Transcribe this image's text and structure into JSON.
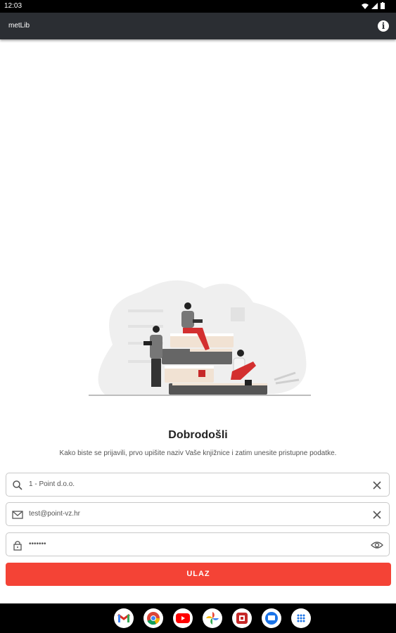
{
  "status": {
    "time": "12:03"
  },
  "appbar": {
    "title": "metLib",
    "info_icon": "info-icon"
  },
  "welcome": {
    "title": "Dobrodošli",
    "subtitle": "Kako biste se prijavili, prvo upišite naziv Vaše knjižnice i zatim unesite pristupne podatke."
  },
  "fields": {
    "library": {
      "value": "1 - Point d.o.o.",
      "icon": "search-icon",
      "action_icon": "clear-icon"
    },
    "email": {
      "value": "test@point-vz.hr",
      "icon": "mail-icon",
      "action_icon": "clear-icon"
    },
    "password": {
      "value": "•••••••",
      "icon": "lock-icon",
      "action_icon": "eye-icon"
    }
  },
  "login_button": {
    "label": "ULAZ"
  },
  "colors": {
    "accent": "#f44336",
    "appbar": "#2b2e33"
  },
  "dock": [
    "gmail-icon",
    "chrome-icon",
    "youtube-icon",
    "photos-icon",
    "app-icon",
    "messages-icon",
    "apps-grid-icon"
  ]
}
